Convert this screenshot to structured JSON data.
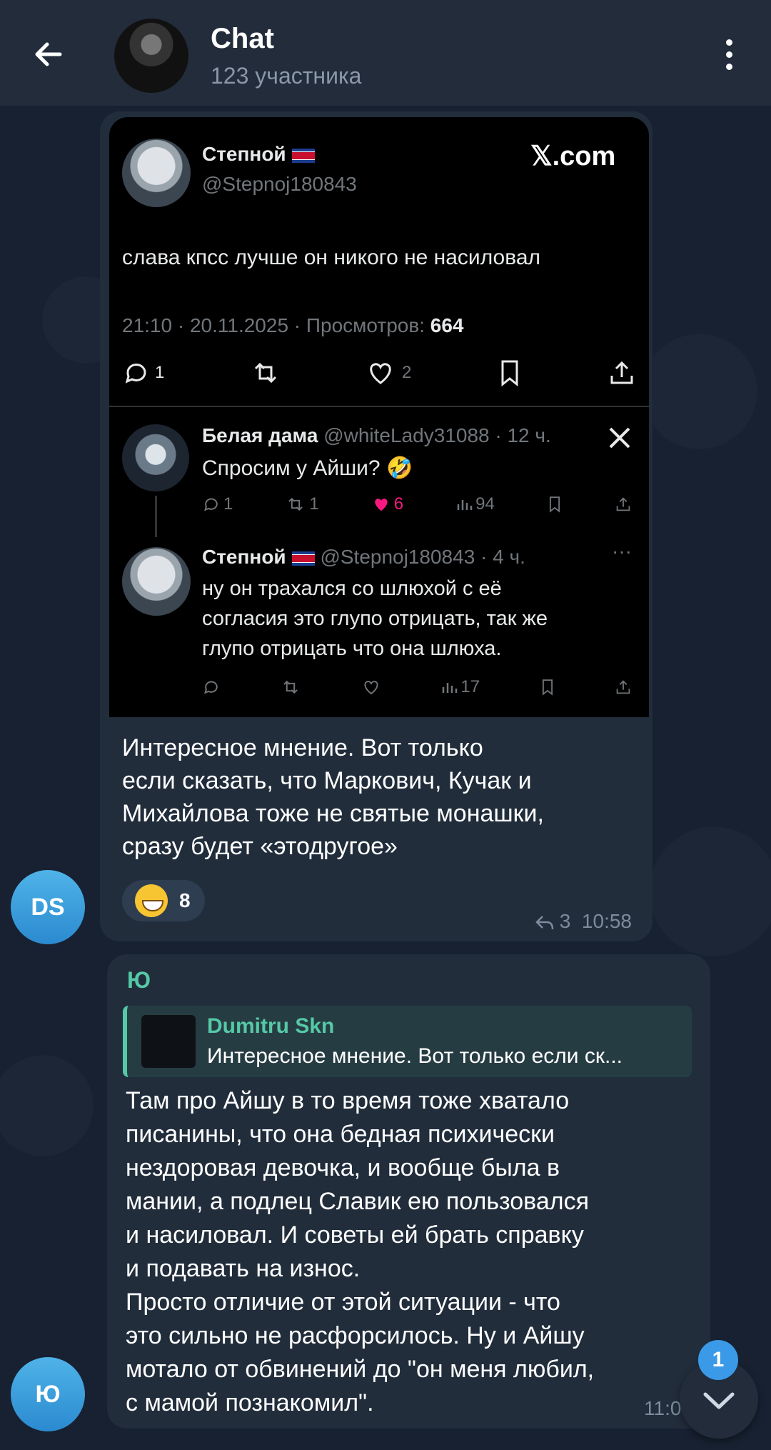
{
  "header": {
    "title": "Chat",
    "subtitle": "123 участника"
  },
  "messages": [
    {
      "embed": {
        "main": {
          "name": "Степной",
          "handle": "@Stepnoj180843",
          "source": "𝕏.com",
          "text": "слава кпсс лучше он никого не насиловал",
          "meta": "21:10 · 20.11.2025 · Просмотров:",
          "views": "664",
          "replies": "1",
          "likes": "2"
        },
        "reply1": {
          "name": "Белая дама",
          "handle": "@whiteLady31088 · 12 ч.",
          "text": "Спросим у Айши? 🤣",
          "replies": "1",
          "retweets": "1",
          "likes": "6",
          "views": "94"
        },
        "reply2": {
          "name": "Степной",
          "handle": "@Stepnoj180843 · 4 ч.",
          "lines": [
            "ну он трахался со шлюхой с её",
            "согласия это глупо отрицать, так же",
            "глупо отрицать что она шлюха."
          ],
          "views": "17"
        }
      },
      "text_lines": [
        "Интересное мнение. Вот только",
        "если сказать, что Маркович, Кучак и",
        "Михайлова тоже не святые монашки,",
        "сразу будет «этодругое»"
      ],
      "reaction_count": "8",
      "reply_count": "3",
      "time": "10:58",
      "avatar_initials": "DS"
    },
    {
      "sender": "Ю",
      "quote_name": "Dumitru Skn",
      "quote_text": "Интересное мнение. Вот только если ск...",
      "text_lines": [
        "Там про Айшу в то время тоже хватало",
        "писанины, что она бедная психически",
        "нездоровая девочка, и вообще была в",
        "мании, а подлец Славик ею пользовался",
        "и насиловал. И советы ей брать справку",
        "и подавать на износ.",
        "Просто отличие от этой ситуации - что",
        "это сильно не расфорсилось. Ну и Айшу",
        "мотало от обвинений до \"он меня любил,",
        "с мамой познакомил\"."
      ],
      "time": "11:09",
      "avatar_initials": "Ю"
    }
  ],
  "scroll_badge": "1",
  "colors": {
    "accent": "#55c9a6",
    "badge": "#3a9ae8",
    "like_pink": "#f91880"
  }
}
